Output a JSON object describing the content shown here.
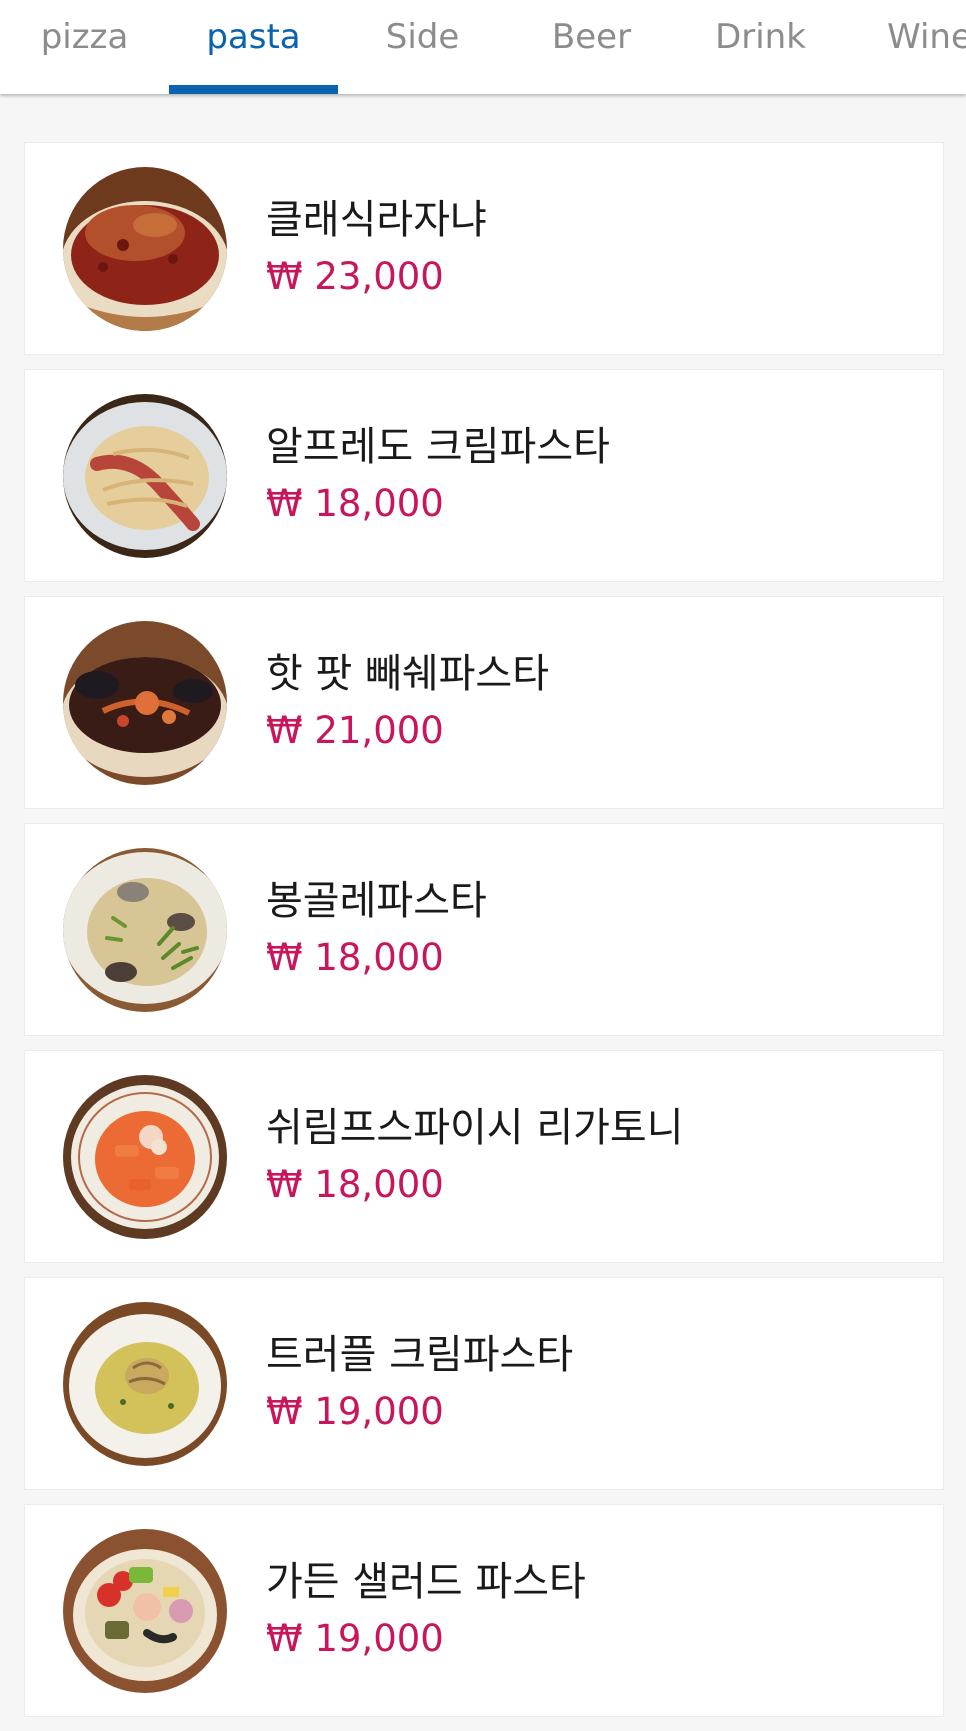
{
  "tabs": [
    {
      "label": "pizza",
      "active": false
    },
    {
      "label": "pasta",
      "active": true
    },
    {
      "label": "Side",
      "active": false
    },
    {
      "label": "Beer",
      "active": false
    },
    {
      "label": "Drink",
      "active": false
    },
    {
      "label": "Wine",
      "active": false
    }
  ],
  "accent_color": "#0a63ae",
  "price_color": "#c8155b",
  "menu_items": [
    {
      "name": "클래식라자냐",
      "price": "₩ 23,000",
      "image": "lasagna-dish-image"
    },
    {
      "name": "알프레도 크림파스타",
      "price": "₩ 18,000",
      "image": "alfredo-pasta-image"
    },
    {
      "name": "핫 팟 빼쉐파스타",
      "price": "₩ 21,000",
      "image": "seafood-pasta-image"
    },
    {
      "name": "봉골레파스타",
      "price": "₩ 18,000",
      "image": "vongole-pasta-image"
    },
    {
      "name": "쉬림프스파이시 리가토니",
      "price": "₩ 18,000",
      "image": "shrimp-rigatoni-image"
    },
    {
      "name": "트러플 크림파스타",
      "price": "₩ 19,000",
      "image": "truffle-pasta-image"
    },
    {
      "name": "가든 샐러드 파스타",
      "price": "₩ 19,000",
      "image": "garden-salad-pasta-image"
    }
  ]
}
